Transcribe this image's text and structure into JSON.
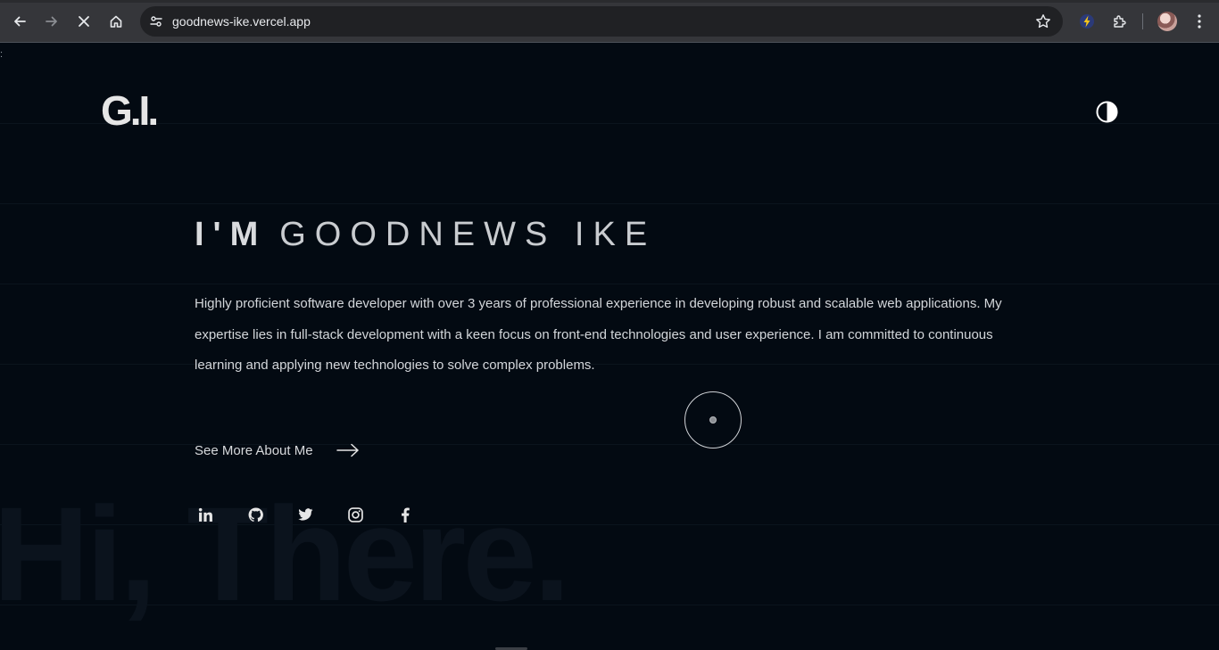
{
  "browser": {
    "url": "goodnews-ike.vercel.app",
    "nav": {
      "back": "back-arrow-icon",
      "forward": "forward-arrow-icon",
      "stop": "close-icon",
      "home": "home-icon"
    },
    "accent": "#e8eaed"
  },
  "page": {
    "stray_text": ":",
    "logo": "G.I.",
    "hero": {
      "prefix": "I'M",
      "name": "GOODNEWS IKE",
      "bio": "Highly proficient software developer with over 3 years of professional experience in developing robust and scalable web applications. My expertise lies in full-stack development with a keen focus on front-end technologies and user experience. I am committed to continuous learning and applying new technologies to solve complex problems."
    },
    "cta": {
      "label": "See More About Me"
    },
    "socials": [
      "linkedin-icon",
      "github-icon",
      "twitter-icon",
      "instagram-icon",
      "facebook-icon"
    ],
    "watermark": "Hi, There.",
    "colors": {
      "background": "#030a12",
      "text": "#d3d6da"
    }
  }
}
